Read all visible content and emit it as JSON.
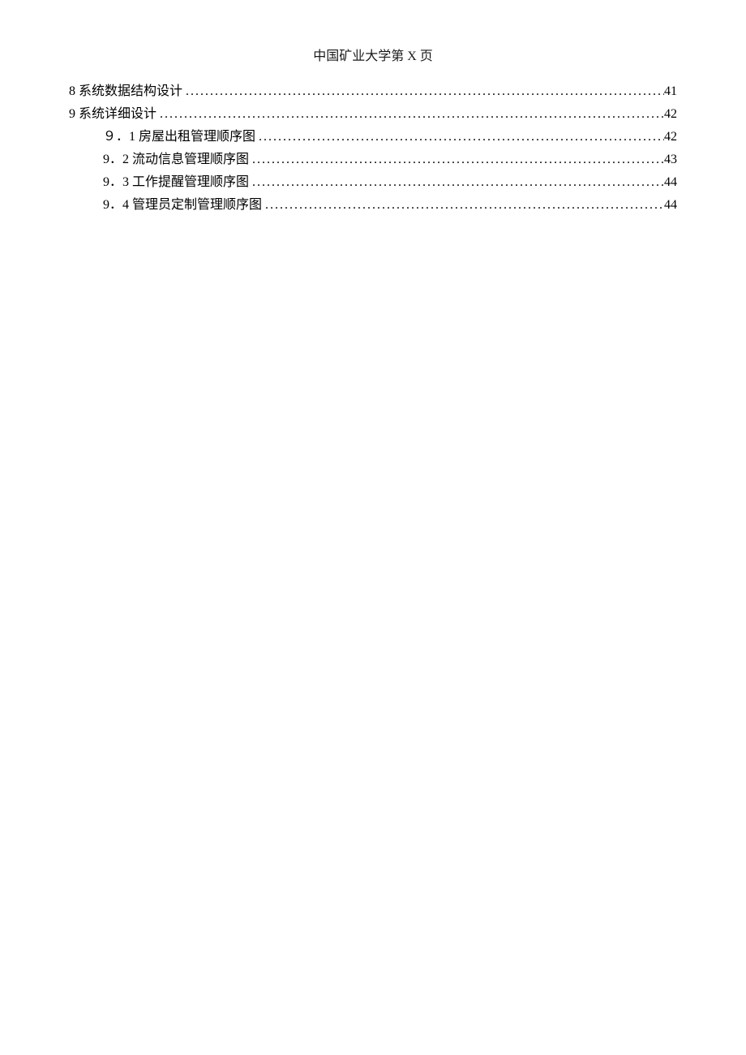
{
  "header": "中国矿业大学第 X 页",
  "toc": [
    {
      "level": 1,
      "title": "8  系统数据结构设计",
      "page": "41"
    },
    {
      "level": 1,
      "title": "9  系统详细设计",
      "page": "42"
    },
    {
      "level": 2,
      "title": "９．1 房屋出租管理顺序图",
      "page": "42"
    },
    {
      "level": 2,
      "title": "9．2 流动信息管理顺序图",
      "page": "43"
    },
    {
      "level": 2,
      "title": "9．3 工作提醒管理顺序图",
      "page": "44"
    },
    {
      "level": 2,
      "title": "9．4 管理员定制管理顺序图",
      "page": "44"
    }
  ]
}
